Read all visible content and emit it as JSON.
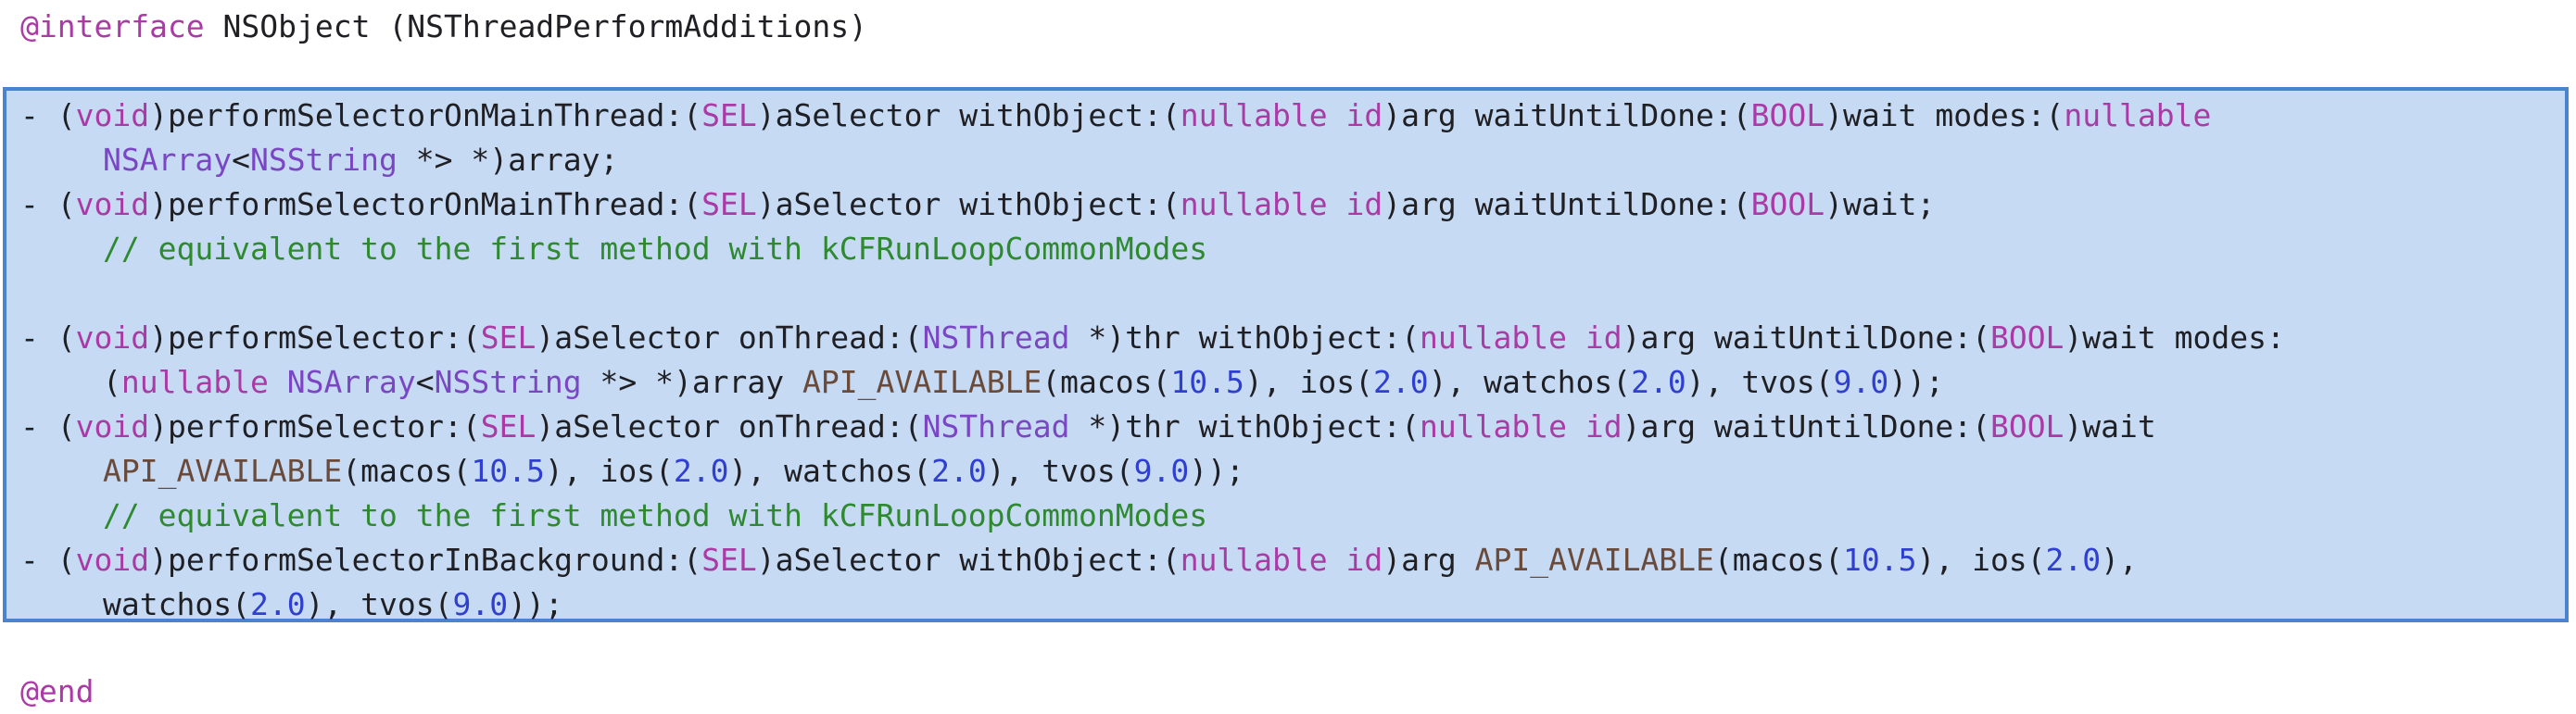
{
  "header": {
    "keyword": "@interface",
    "text": " NSObject (NSThreadPerformAdditions)"
  },
  "methods": {
    "m1_l1": {
      "t0": "- (",
      "t1": "void",
      "t2": ")performSelectorOnMainThread:(",
      "t3": "SEL",
      "t4": ")aSelector withObject:(",
      "t5": "nullable",
      "t6": " ",
      "t7": "id",
      "t8": ")arg waitUntilDone:(",
      "t9": "BOOL",
      "t10": ")wait modes:(",
      "t11": "nullable"
    },
    "m1_l2": {
      "t0": "NSArray",
      "t1": "<",
      "t2": "NSString",
      "t3": " *> *)array;"
    },
    "m2_l1": {
      "t0": "- (",
      "t1": "void",
      "t2": ")performSelectorOnMainThread:(",
      "t3": "SEL",
      "t4": ")aSelector withObject:(",
      "t5": "nullable",
      "t6": " ",
      "t7": "id",
      "t8": ")arg waitUntilDone:(",
      "t9": "BOOL",
      "t10": ")wait;"
    },
    "m2_comment": "// equivalent to the first method with kCFRunLoopCommonModes",
    "m3_l1": {
      "t0": "- (",
      "t1": "void",
      "t2": ")performSelector:(",
      "t3": "SEL",
      "t4": ")aSelector onThread:(",
      "t5": "NSThread",
      "t6": " *)thr withObject:(",
      "t7": "nullable",
      "t8": " ",
      "t9": "id",
      "t10": ")arg waitUntilDone:(",
      "t11": "BOOL",
      "t12": ")wait modes:"
    },
    "m3_l2": {
      "t0": "(",
      "t1": "nullable",
      "t2": " ",
      "t3": "NSArray",
      "t4": "<",
      "t5": "NSString",
      "t6": " *> *)array ",
      "t7": "API_AVAILABLE",
      "t8": "(macos(",
      "t9": "10.5",
      "t10": "), ios(",
      "t11": "2.0",
      "t12": "), watchos(",
      "t13": "2.0",
      "t14": "), tvos(",
      "t15": "9.0",
      "t16": "));"
    },
    "m4_l1": {
      "t0": "- (",
      "t1": "void",
      "t2": ")performSelector:(",
      "t3": "SEL",
      "t4": ")aSelector onThread:(",
      "t5": "NSThread",
      "t6": " *)thr withObject:(",
      "t7": "nullable",
      "t8": " ",
      "t9": "id",
      "t10": ")arg waitUntilDone:(",
      "t11": "BOOL",
      "t12": ")wait"
    },
    "m4_l2": {
      "t0": "API_AVAILABLE",
      "t1": "(macos(",
      "t2": "10.5",
      "t3": "), ios(",
      "t4": "2.0",
      "t5": "), watchos(",
      "t6": "2.0",
      "t7": "), tvos(",
      "t8": "9.0",
      "t9": "));"
    },
    "m4_comment": "// equivalent to the first method with kCFRunLoopCommonModes",
    "m5_l1": {
      "t0": "- (",
      "t1": "void",
      "t2": ")performSelectorInBackground:(",
      "t3": "SEL",
      "t4": ")aSelector withObject:(",
      "t5": "nullable",
      "t6": " ",
      "t7": "id",
      "t8": ")arg ",
      "t9": "API_AVAILABLE",
      "t10": "(macos(",
      "t11": "10.5",
      "t12": "), ios(",
      "t13": "2.0",
      "t14": "),"
    },
    "m5_l2": {
      "t0": "watchos(",
      "t1": "2.0",
      "t2": "), tvos(",
      "t3": "9.0",
      "t4": "));"
    }
  },
  "footer": {
    "keyword": "@end"
  },
  "colors": {
    "selection_fill": "#c6dbf3",
    "selection_border": "#4a84cf",
    "keyword": "#aa3aa5",
    "type": "#7b46c4",
    "number": "#2f3fd0",
    "comment": "#2f8a2f"
  }
}
